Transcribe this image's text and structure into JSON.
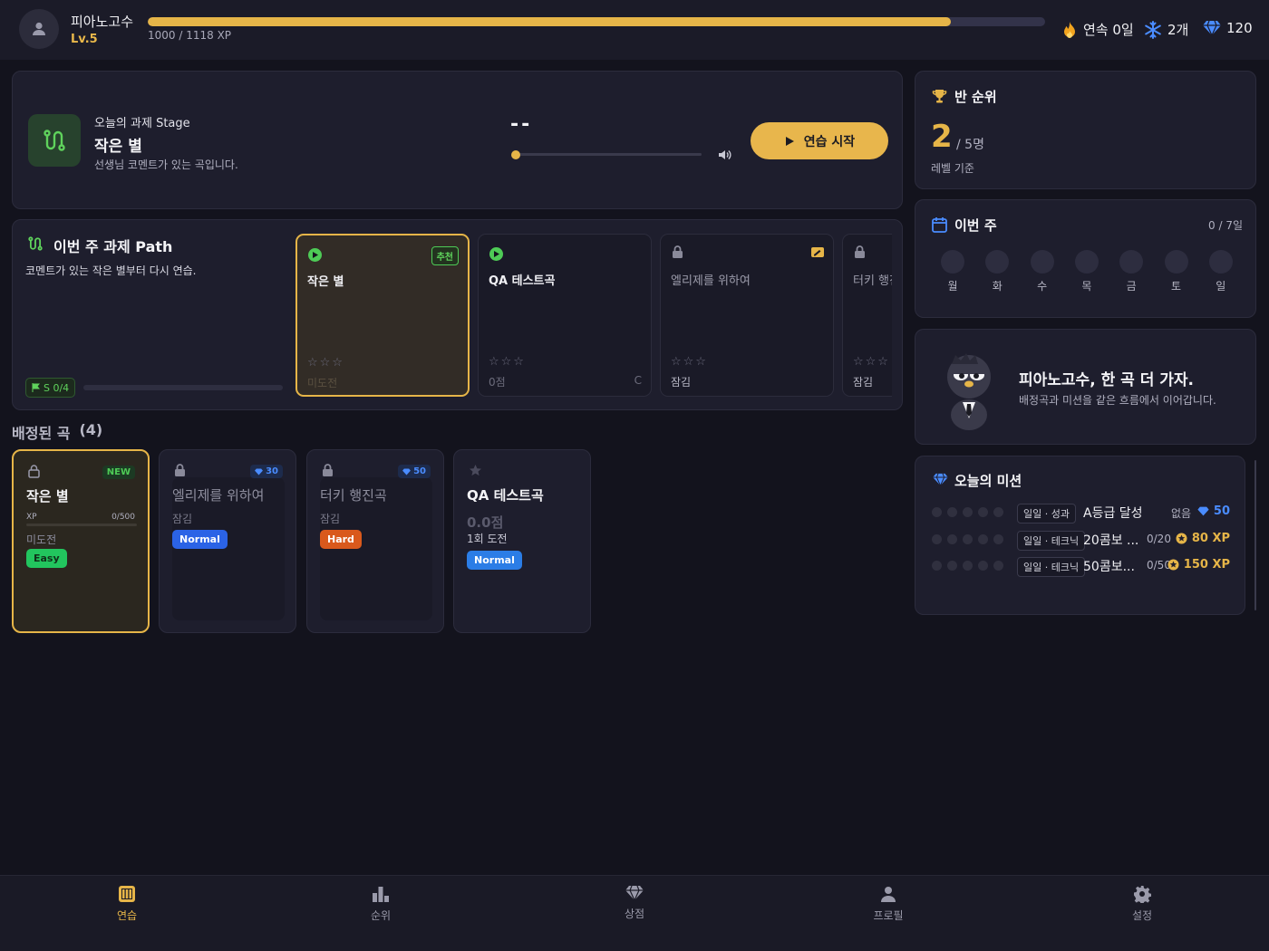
{
  "header": {
    "username": "피아노고수",
    "level": "Lv.5",
    "xp_text": "1000 / 1118 XP",
    "xp_progress": 0.895,
    "streak": "연속 0일",
    "freeze": "2개",
    "gems": "120"
  },
  "stage": {
    "subtitle": "오늘의 과제 Stage",
    "title": "작은 별",
    "desc": "선생님 코멘트가 있는 곡입니다.",
    "time": "--",
    "start_label": "연습 시작"
  },
  "path": {
    "title": "이번 주 과제 Path",
    "desc": "코멘트가 있는 작은 별부터 다시 연습.",
    "flag": "S 0/4",
    "cards": [
      {
        "name": "작은 별",
        "badge": "추천",
        "stars": "☆☆☆",
        "status": "미도전"
      },
      {
        "name": "QA 테스트곡",
        "stars": "☆☆☆",
        "status": "0점",
        "grade": "C"
      },
      {
        "name": "엘리제를 위하여",
        "stars": "☆☆☆",
        "status": "잠김"
      },
      {
        "name": "터키 행진곡",
        "stars": "☆☆☆",
        "status": "잠김"
      }
    ]
  },
  "assigned": {
    "heading": "배정된 곡",
    "count": "(4)",
    "songs": [
      {
        "name": "작은 별",
        "badge": "NEW",
        "xp_label": "XP",
        "xp_val": "0/500",
        "status": "미도전",
        "difficulty": "Easy"
      },
      {
        "name": "엘리제를 위하여",
        "badge": "30",
        "status": "잠김",
        "difficulty": "Normal"
      },
      {
        "name": "터키 행진곡",
        "badge": "50",
        "status": "잠김",
        "difficulty": "Hard"
      },
      {
        "name": "QA 테스트곡",
        "score": "0.0점",
        "attempts": "1회 도전",
        "difficulty": "Normal"
      }
    ]
  },
  "rank": {
    "title": "반 순위",
    "value": "2",
    "total": "/ 5명",
    "basis": "레벨 기준"
  },
  "week": {
    "title": "이번 주",
    "count": "0 / 7일",
    "days": [
      "월",
      "화",
      "수",
      "목",
      "금",
      "토",
      "일"
    ]
  },
  "mascot": {
    "title": "피아노고수, 한 곡 더 가자.",
    "desc": "배정곡과 미션을 같은 흐름에서 이어갑니다."
  },
  "missions": {
    "title": "오늘의 미션",
    "items": [
      {
        "tag": "일일 · 성과",
        "name": "A등급 달성",
        "progress": "없음",
        "reward": "50",
        "reward_type": "gem"
      },
      {
        "tag": "일일 · 테크닉",
        "name": "20콤보 ...",
        "progress": "0/20",
        "reward": "80 XP",
        "reward_type": "xp"
      },
      {
        "tag": "일일 · 테크닉",
        "name": "50콤보...",
        "progress": "0/50",
        "reward": "150 XP",
        "reward_type": "xp"
      }
    ]
  },
  "nav": {
    "items": [
      "연습",
      "순위",
      "상점",
      "프로필",
      "설정"
    ],
    "active": 0
  },
  "colors": {
    "accent": "#e6b548",
    "green": "#4ecb56",
    "blue": "#4a8cff",
    "easy": "#22c55e",
    "normal": "#2b63e6",
    "hard": "#d9591c"
  }
}
